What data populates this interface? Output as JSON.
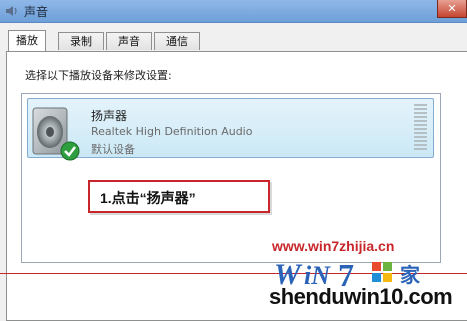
{
  "window": {
    "title": "声音",
    "close_label": "✕"
  },
  "tabs": [
    {
      "label": "播放",
      "active": true
    },
    {
      "label": "录制",
      "active": false
    },
    {
      "label": "声音",
      "active": false
    },
    {
      "label": "通信",
      "active": false
    }
  ],
  "instruction": "选择以下播放设备来修改设置:",
  "devices": [
    {
      "name": "扬声器",
      "driver": "Realtek High Definition Audio",
      "status": "默认设备",
      "icon": "speaker-icon",
      "badge_icon": "default-check-icon"
    }
  ],
  "callout": {
    "text": "1.点击“扬声器”",
    "border_color": "#c8262a"
  },
  "watermark": {
    "url": "www.win7zhijia.cn",
    "logo_text": "Win7",
    "site": "shenduwin10.com",
    "color": "#c8262a"
  },
  "colors": {
    "selection_bg": "#cbe8f6",
    "selection_border": "#84acd0",
    "titlebar": "#6d9fd9"
  }
}
